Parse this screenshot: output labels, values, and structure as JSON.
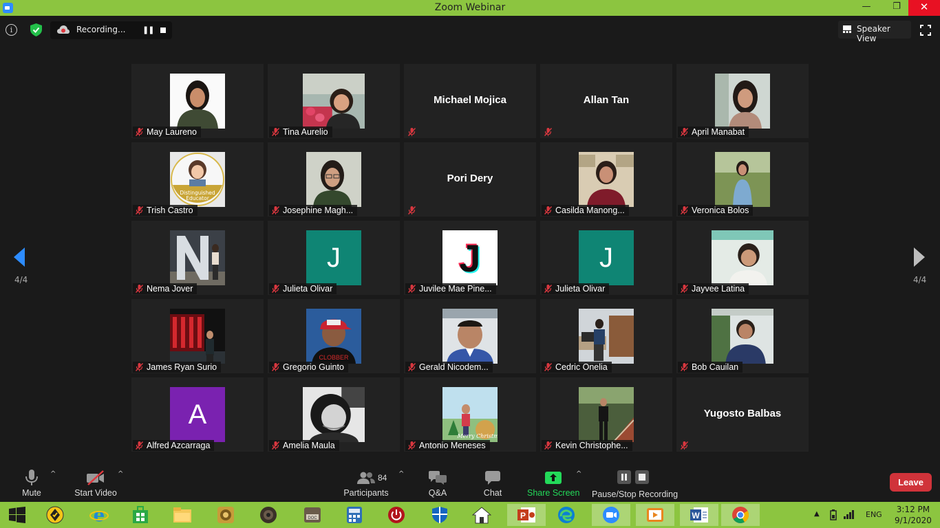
{
  "window": {
    "title": "Zoom Webinar",
    "minimize": "—",
    "restore": "❐",
    "close": "✕"
  },
  "topbar": {
    "recording_label": "Recording...",
    "speaker_view_label": "Speaker View"
  },
  "pagination": {
    "left": "4/4",
    "right": "4/4"
  },
  "participants": [
    {
      "name": "May Laureno",
      "photo": "portrait-woman"
    },
    {
      "name": "Tina Aurelio",
      "photo": "woman-garden"
    },
    {
      "name": "Michael Mojica",
      "photo": ""
    },
    {
      "name": "Allan Tan",
      "photo": ""
    },
    {
      "name": "April Manabat",
      "photo": "woman-selfie"
    },
    {
      "name": "Trish Castro",
      "photo": "distinguished-educator-badge",
      "badge_text": "Distinguished Educator"
    },
    {
      "name": "Josephine Magh...",
      "photo": "woman-glasses"
    },
    {
      "name": "Pori Dery",
      "photo": ""
    },
    {
      "name": "Casilda Manong...",
      "photo": "woman-office"
    },
    {
      "name": "Veronica Bolos",
      "photo": "woman-outdoor"
    },
    {
      "name": "Nema Jover",
      "photo": "letter-n-statue"
    },
    {
      "name": "Julieta Olivar",
      "photo": "initial",
      "initial": "J",
      "initial_color": "#0f8574"
    },
    {
      "name": "Juvilee Mae Pine...",
      "photo": "tiktok-j",
      "initial": "J"
    },
    {
      "name": "Julieta Olivar",
      "photo": "initial",
      "initial": "J",
      "initial_color": "#0f8574"
    },
    {
      "name": "Jayvee Latina",
      "photo": "man-selfie"
    },
    {
      "name": "James Ryan Surio",
      "photo": "man-night-lights"
    },
    {
      "name": "Gregorio Guinto",
      "photo": "man-cap"
    },
    {
      "name": "Gerald Nicodem...",
      "photo": "man-car"
    },
    {
      "name": "Cedric Onelia",
      "photo": "man-office"
    },
    {
      "name": "Bob Cauilan",
      "photo": "man-plants"
    },
    {
      "name": "Alfred Azcarraga",
      "photo": "initial",
      "initial": "A",
      "initial_color": "#7a22b0"
    },
    {
      "name": "Amelia Maula",
      "photo": "woman-bw"
    },
    {
      "name": "Antonio Meneses",
      "photo": "christmas-photo",
      "caption": "Merry Christmas"
    },
    {
      "name": "Kevin Christophe...",
      "photo": "man-stairs"
    },
    {
      "name": "Yugosto Balbas",
      "photo": ""
    }
  ],
  "toolbar": {
    "mute_label": "Mute",
    "start_video_label": "Start Video",
    "participants_label": "Participants",
    "participants_count": "84",
    "qa_label": "Q&A",
    "chat_label": "Chat",
    "share_screen_label": "Share Screen",
    "pause_stop_label": "Pause/Stop Recording",
    "leave_label": "Leave"
  },
  "taskbar": {
    "apps": [
      "windows-start",
      "norton",
      "internet-explorer",
      "store",
      "file-explorer",
      "app-gold",
      "speaker-app",
      "doc-app",
      "calculator-app",
      "power-app",
      "defender",
      "home-app",
      "powerpoint",
      "edge",
      "zoom",
      "media-player",
      "word",
      "chrome"
    ],
    "language": "ENG",
    "time": "3:12 PM",
    "date": "9/1/2020"
  },
  "colors": {
    "title_bar": "#8cc540",
    "leave": "#d0333a",
    "share_screen": "#23d959",
    "mute_red": "#d9373f"
  }
}
